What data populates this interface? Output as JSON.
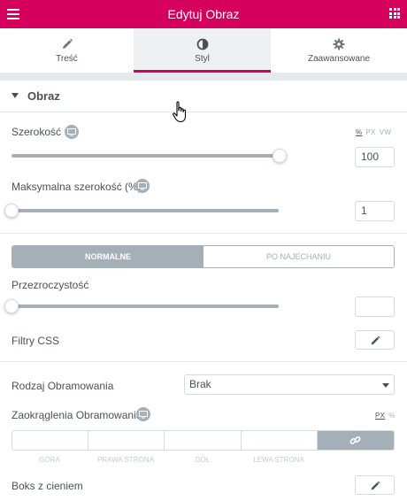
{
  "header": {
    "title": "Edytuj Obraz",
    "menu_icon": "hamburger-icon",
    "apps_icon": "grid-icon",
    "color": "#d5005e"
  },
  "tabs": [
    {
      "label": "Treść",
      "icon": "pencil-icon",
      "active": false
    },
    {
      "label": "Styl",
      "icon": "half-circle-icon",
      "active": true
    },
    {
      "label": "Zaawansowane",
      "icon": "gear-icon",
      "active": false
    }
  ],
  "section": {
    "title": "Obraz"
  },
  "width": {
    "label": "Szerokość",
    "units": [
      "%",
      "PX",
      "VW"
    ],
    "active_unit": "%",
    "value": "100",
    "slider_fraction": 1.0
  },
  "max_width": {
    "label": "Maksymalna szerokość (%)",
    "value": "1",
    "slider_fraction": 0.0
  },
  "state_toggle": {
    "normal": "NORMALNE",
    "hover": "PO NAJECHANIU",
    "active": "normal"
  },
  "opacity": {
    "label": "Przezroczystość",
    "value": "",
    "slider_fraction": 0.0
  },
  "css_filters": {
    "label": "Filtry CSS"
  },
  "border_type": {
    "label": "Rodzaj Obramowania",
    "selected": "Brak"
  },
  "border_radius": {
    "label": "Zaokrąglenia Obramowania",
    "units": [
      "PX",
      "%"
    ],
    "active_unit": "PX",
    "sides": [
      "GÓRA",
      "PRAWA STRONA",
      "DÓŁ",
      "LEWA STRONA"
    ]
  },
  "box_shadow": {
    "label": "Boks z cieniem"
  }
}
